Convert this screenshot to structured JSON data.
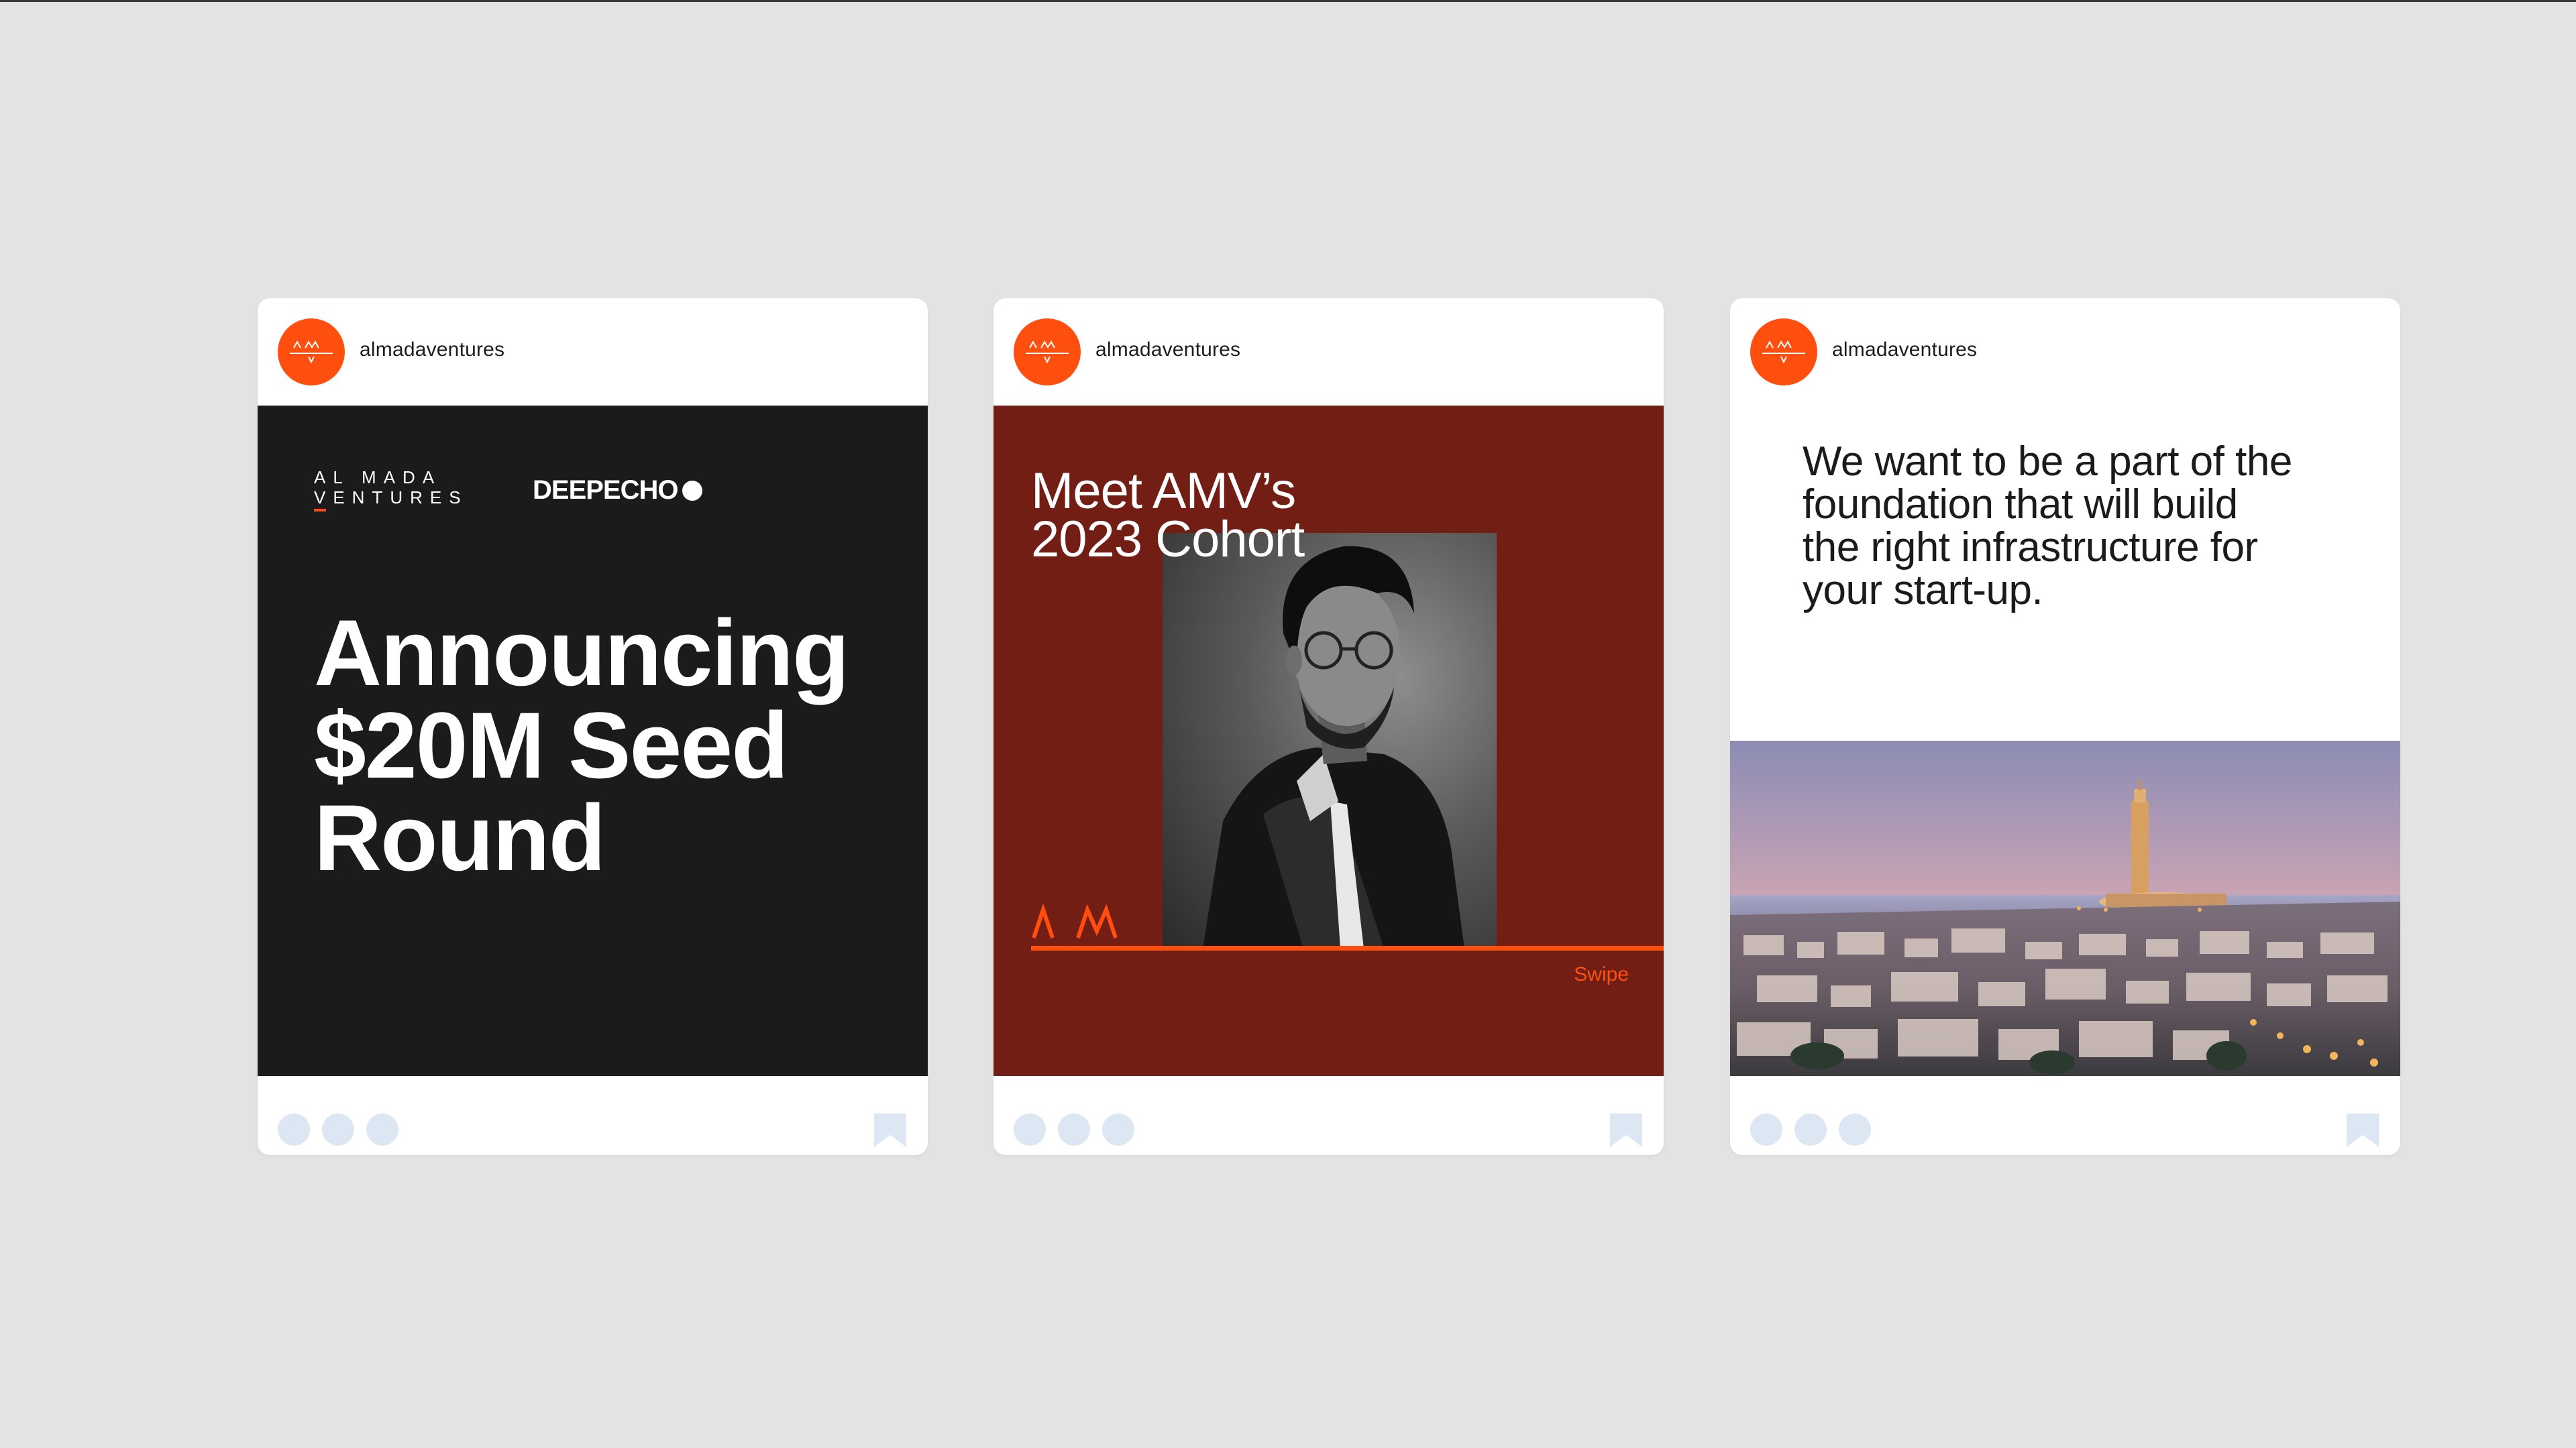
{
  "colors": {
    "background": "#e3e3e3",
    "card": "#ffffff",
    "brand_orange": "#fe4f0f",
    "dark": "#1b1b1b",
    "maroon": "#731e15",
    "footer_dot": "#dde7f4"
  },
  "posts": [
    {
      "username": "almadaventures",
      "avatar_icon": "am-monogram-icon",
      "logo_lines": [
        "AL MADA",
        "VENTURES"
      ],
      "partner_logo": "DEEPECHO",
      "headline_lines": [
        "Announcing",
        "$20M Seed",
        "Round"
      ],
      "footer_icons": [
        "like-icon",
        "comment-icon",
        "share-icon",
        "bookmark-icon"
      ]
    },
    {
      "username": "almadaventures",
      "avatar_icon": "am-monogram-icon",
      "headline_lines": [
        "Meet AMV’s",
        "2023 Cohort"
      ],
      "mark_icon": "am-mark-icon",
      "swipe_label": "Swipe",
      "footer_icons": [
        "like-icon",
        "comment-icon",
        "share-icon",
        "bookmark-icon"
      ]
    },
    {
      "username": "almadaventures",
      "avatar_icon": "am-monogram-icon",
      "quote_lines": [
        "We want to be a part of the",
        "foundation that will build",
        "the right infrastructure for",
        "your start-up."
      ],
      "footer_icons": [
        "like-icon",
        "comment-icon",
        "share-icon",
        "bookmark-icon"
      ]
    }
  ]
}
